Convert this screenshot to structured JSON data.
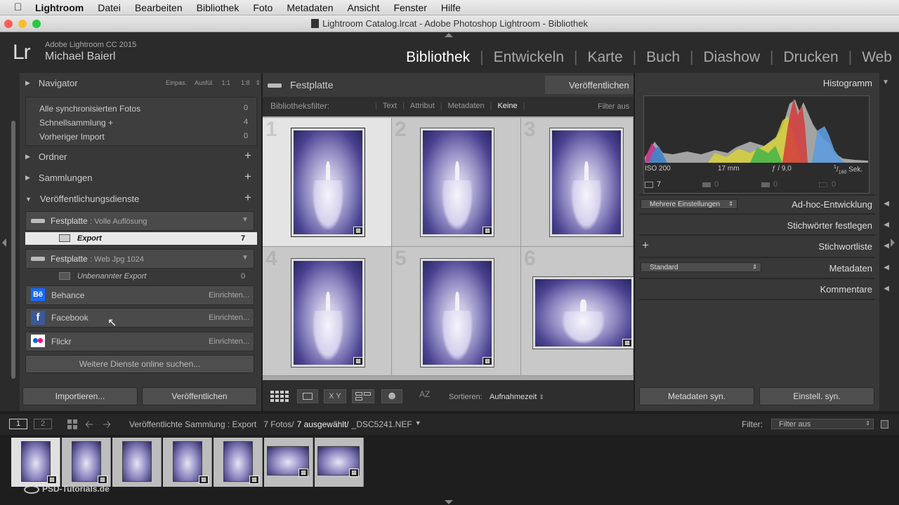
{
  "menubar": {
    "app": "Lightroom",
    "items": [
      "Datei",
      "Bearbeiten",
      "Bibliothek",
      "Foto",
      "Metadaten",
      "Ansicht",
      "Fenster",
      "Hilfe"
    ]
  },
  "window": {
    "title": "Lightroom Catalog.lrcat - Adobe Photoshop Lightroom - Bibliothek"
  },
  "identity": {
    "logo": "Lr",
    "version": "Adobe Lightroom CC 2015",
    "user": "Michael Baierl"
  },
  "modules": [
    "Bibliothek",
    "Entwickeln",
    "Karte",
    "Buch",
    "Diashow",
    "Drucken",
    "Web"
  ],
  "left": {
    "navigator": {
      "label": "Navigator",
      "zoom": [
        "Einpas.",
        "Ausfül.",
        "1:1",
        "1:8"
      ]
    },
    "catalog": [
      {
        "label": "Alle synchronisierten Fotos",
        "count": "0"
      },
      {
        "label": "Schnellsammlung +",
        "count": "4"
      },
      {
        "label": "Vorheriger Import",
        "count": "0"
      }
    ],
    "ordner": "Ordner",
    "sammlungen": "Sammlungen",
    "publish": {
      "label": "Veröffentlichungsdienste",
      "fest1": {
        "name": "Festplatte",
        "desc": ": Volle Auflösung",
        "child": "Export",
        "count": "7"
      },
      "fest2": {
        "name": "Festplatte",
        "desc": ": Web Jpg 1024",
        "child": "Unbenannter Export",
        "count": "0"
      },
      "services": [
        {
          "name": "Behance",
          "action": "Einrichten..."
        },
        {
          "name": "Facebook",
          "action": "Einrichten..."
        },
        {
          "name": "Flickr",
          "action": "Einrichten..."
        }
      ],
      "more": "Weitere Dienste online suchen..."
    },
    "import_btn": "Importieren...",
    "publish_btn": "Veröffentlichen"
  },
  "center": {
    "title": "Festplatte",
    "publish_now": "Veröffentlichen",
    "filter": {
      "label": "Bibliotheksfilter:",
      "options": [
        "Text",
        "Attribut",
        "Metadaten",
        "Keine"
      ],
      "active": "Keine",
      "off": "Filter aus"
    },
    "cells": [
      "1",
      "2",
      "3",
      "4",
      "5",
      "6"
    ],
    "toolbar": {
      "sort_label": "Sortieren:",
      "sort_value": "Aufnahmezeit",
      "xy": "X Y",
      "az": "AZ"
    }
  },
  "right": {
    "histogram": {
      "label": "Histogramm",
      "iso": "ISO 200",
      "focal": "17 mm",
      "aperture": "ƒ / 9,0",
      "shutter_num": "1",
      "shutter_den": "160",
      "shutter_unit": "Sek.",
      "counts": [
        "7",
        "0",
        "0",
        "0"
      ]
    },
    "quick_preset": "Mehrere Einstellungen",
    "quick_label": "Ad-hoc-Entwicklung",
    "keywording": "Stichwörter festlegen",
    "keyword_list": "Stichwortliste",
    "meta_preset": "Standard",
    "metadata": "Metadaten",
    "comments": "Kommentare",
    "sync_meta": "Metadaten syn.",
    "sync_settings": "Einstell. syn."
  },
  "filmstrip": {
    "pages": [
      "1",
      "2"
    ],
    "source": "Veröffentlichte Sammlung : Export",
    "count": "7 Fotos/",
    "selected": "7 ausgewählt/",
    "file": "_DSC5241.NEF",
    "filter_label": "Filter:",
    "filter_value": "Filter aus"
  },
  "watermark": "PSD-Tutorials.de",
  "colors": {
    "accent": "#ffffff",
    "panel": "#383838",
    "grid": "#c8c8c8"
  }
}
